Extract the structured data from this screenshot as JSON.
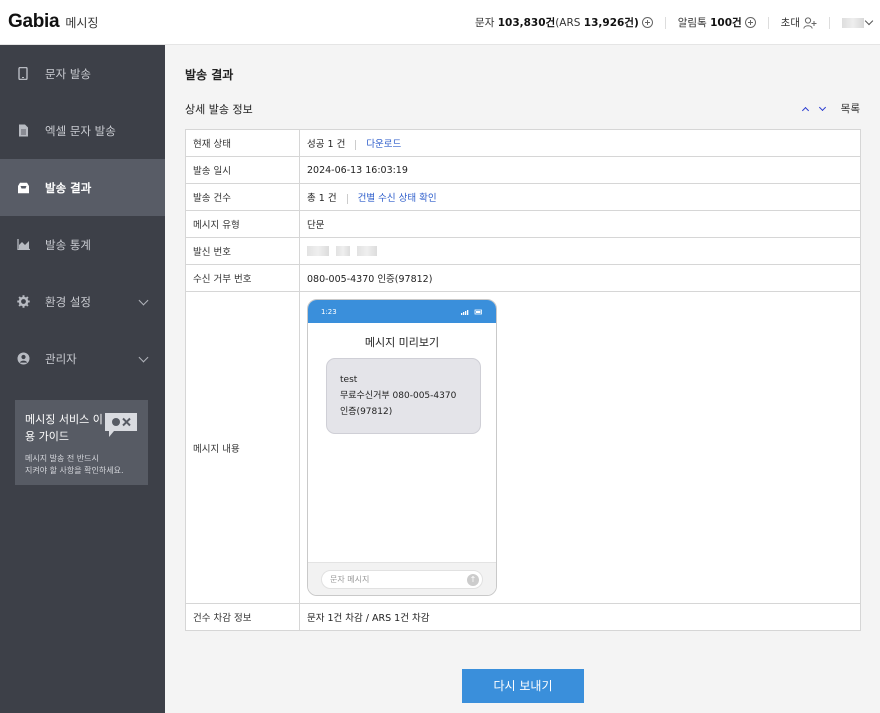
{
  "header": {
    "brand": "Gabia",
    "brand_sub": "메시징",
    "sms_label": "문자",
    "sms_count": "103,830건",
    "ars_label": "(ARS",
    "ars_count": "13,926건)",
    "alimtalk_label": "알림톡",
    "alimtalk_count": "100건",
    "invite_label": "초대"
  },
  "sidebar": {
    "items": [
      {
        "label": "문자 발송",
        "icon": "phone-icon"
      },
      {
        "label": "엑셀 문자 발송",
        "icon": "excel-icon"
      },
      {
        "label": "발송 결과",
        "icon": "inbox-icon",
        "active": true
      },
      {
        "label": "발송 통계",
        "icon": "chart-icon"
      },
      {
        "label": "환경 설정",
        "icon": "gear-icon"
      },
      {
        "label": "관리자",
        "icon": "user-circle-icon"
      }
    ],
    "guide": {
      "title": "메시징 서비스 이용 가이드",
      "desc_line1": "메시지 발송 전 반드시",
      "desc_line2": "지켜야 할 사항을 확인하세요."
    }
  },
  "main": {
    "page_title": "발송 결과",
    "section_title": "상세 발송 정보",
    "list_label": "목록",
    "rows": {
      "status_label": "현재 상태",
      "status_value": "성공 1 건",
      "download_label": "다운로드",
      "send_time_label": "발송 일시",
      "send_time_value": "2024-06-13 16:03:19",
      "count_label": "발송 건수",
      "count_value": "총 1 건",
      "count_link": "건별 수신 상태 확인",
      "msg_type_label": "메시지 유형",
      "msg_type_value": "단문",
      "sender_label": "발신 번호",
      "reject_label": "수신 거부 번호",
      "reject_value": "080-005-4370 인증(97812)",
      "content_label": "메시지 내용",
      "deduct_label": "건수 차감 정보",
      "deduct_value": "문자 1건 차감 / ARS 1건 차감"
    },
    "phone": {
      "time": "1:23",
      "preview_title": "메시지 미리보기",
      "message_line1": "test",
      "message_line2": "무료수신거부 080-005-4370",
      "message_line3": "인증(97812)",
      "input_placeholder": "문자 메시지"
    },
    "resend_label": "다시 보내기"
  },
  "colors": {
    "sidebar_bg": "#3d4048",
    "sidebar_active": "#585c66",
    "accent": "#3a8fdb",
    "link": "#2e5ecb"
  }
}
